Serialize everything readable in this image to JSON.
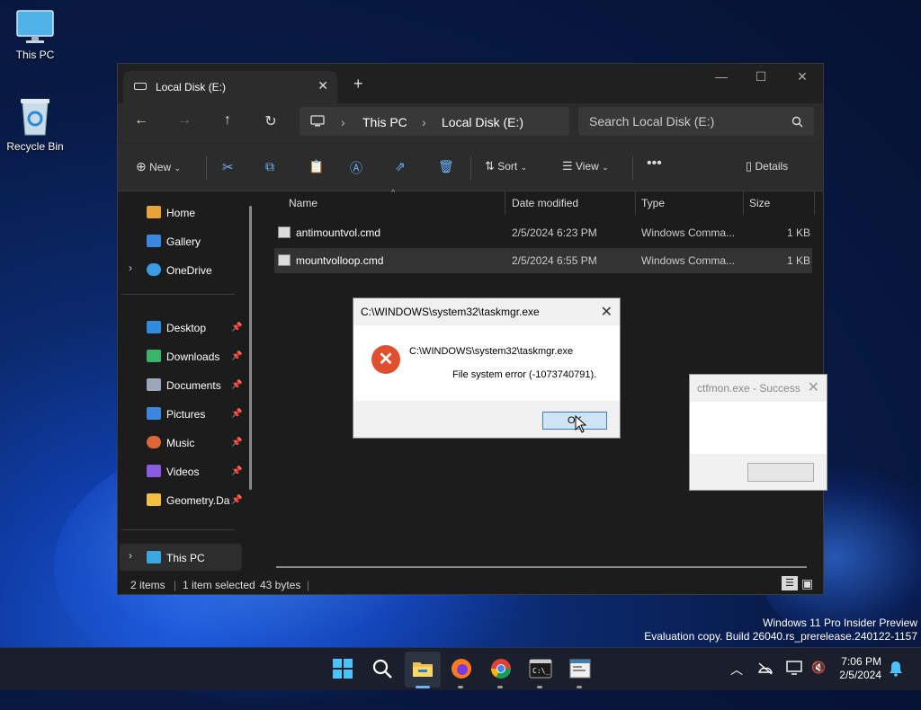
{
  "desktop": {
    "icons": [
      {
        "label": "This PC",
        "icon": "monitor-icon"
      },
      {
        "label": "Recycle Bin",
        "icon": "recycle-bin-icon"
      }
    ],
    "watermark_line1": "Windows 11 Pro Insider Preview",
    "watermark_line2": "Evaluation copy. Build 26040.rs_prerelease.240122-1157"
  },
  "explorer": {
    "tab_title": "Local Disk (E:)",
    "address": {
      "segment1": "This PC",
      "segment2": "Local Disk (E:)"
    },
    "search_placeholder": "Search Local Disk (E:)",
    "toolbar": {
      "new_label": "New",
      "sort_label": "Sort",
      "view_label": "View",
      "details_label": "Details"
    },
    "sidebar": {
      "items": [
        {
          "label": "Home",
          "color": "#e8a33b"
        },
        {
          "label": "Gallery",
          "color": "#3a86e0"
        },
        {
          "label": "OneDrive",
          "color": "#3a9de0"
        },
        {
          "label": "Desktop",
          "color": "#2f8be0"
        },
        {
          "label": "Downloads",
          "color": "#3ab36b"
        },
        {
          "label": "Documents",
          "color": "#9aa7b8"
        },
        {
          "label": "Pictures",
          "color": "#3a86e0"
        },
        {
          "label": "Music",
          "color": "#e0643a"
        },
        {
          "label": "Videos",
          "color": "#8a5ae0"
        },
        {
          "label": "Geometry.Da",
          "color": "#f0c040"
        },
        {
          "label": "This PC",
          "color": "#3aa8e0"
        }
      ]
    },
    "columns": {
      "name": "Name",
      "date": "Date modified",
      "type": "Type",
      "size": "Size"
    },
    "files": [
      {
        "name": "antimountvol.cmd",
        "date": "2/5/2024 6:23 PM",
        "type": "Windows Comma...",
        "size": "1 KB"
      },
      {
        "name": "mountvolloop.cmd",
        "date": "2/5/2024 6:55 PM",
        "type": "Windows Comma...",
        "size": "1 KB"
      }
    ],
    "status": {
      "items": "2 items",
      "selected": "1 item selected",
      "bytes": "43 bytes"
    }
  },
  "error_dialog": {
    "title": "C:\\WINDOWS\\system32\\taskmgr.exe",
    "line1": "C:\\WINDOWS\\system32\\taskmgr.exe",
    "line2": "File system error (-1073740791).",
    "ok_label": "OK"
  },
  "ctfmon_dialog": {
    "title": "ctfmon.exe - Success"
  },
  "taskbar": {
    "time": "7:06 PM",
    "date": "2/5/2024",
    "apps": [
      "windows-start-icon",
      "search-icon",
      "file-explorer-icon",
      "firefox-icon",
      "chrome-icon",
      "terminal-icon",
      "dialog-app-icon"
    ]
  }
}
